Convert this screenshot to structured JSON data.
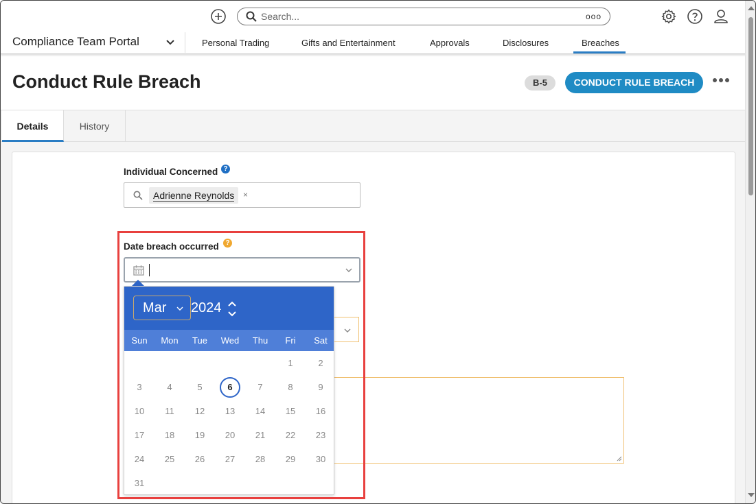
{
  "topbar": {
    "search_placeholder": "Search...",
    "search_options": "ooo",
    "add_icon": "plus-circle-icon",
    "settings_icon": "gear-icon",
    "help_icon": "question-circle-icon",
    "user_icon": "user-icon"
  },
  "nav": {
    "portal": "Compliance Team Portal",
    "items": [
      "Personal Trading",
      "Gifts and Entertainment",
      "Approvals",
      "Disclosures",
      "Breaches"
    ],
    "active": "Breaches"
  },
  "header": {
    "title": "Conduct Rule Breach",
    "badge": "B-5",
    "primary_button": "CONDUCT RULE BREACH",
    "more_icon": "ellipsis-icon"
  },
  "tabs": [
    "Details",
    "History"
  ],
  "form": {
    "individual_label": "Individual Concerned",
    "individual_value": "Adrienne Reynolds",
    "chip_remove": "×",
    "date_label": "Date breach occurred",
    "help_glyph": "?",
    "date_value": ""
  },
  "calendar": {
    "month": "Mar",
    "year": "2024",
    "weekdays": [
      "Sun",
      "Mon",
      "Tue",
      "Wed",
      "Thu",
      "Fri",
      "Sat"
    ],
    "days": [
      1,
      2,
      3,
      4,
      5,
      6,
      7,
      8,
      9,
      10,
      11,
      12,
      13,
      14,
      15,
      16,
      17,
      18,
      19,
      20,
      21,
      22,
      23,
      24,
      25,
      26,
      27,
      28,
      29,
      30,
      31
    ],
    "first_weekday_index": 5,
    "today": 6
  },
  "colors": {
    "primary": "#1f8bc4",
    "calendar_header": "#2e65c8",
    "calendar_weekday_row": "#4f7fd8",
    "highlight": "#e8403e",
    "help_blue": "#1f6fc4",
    "help_orange": "#f0a830"
  }
}
